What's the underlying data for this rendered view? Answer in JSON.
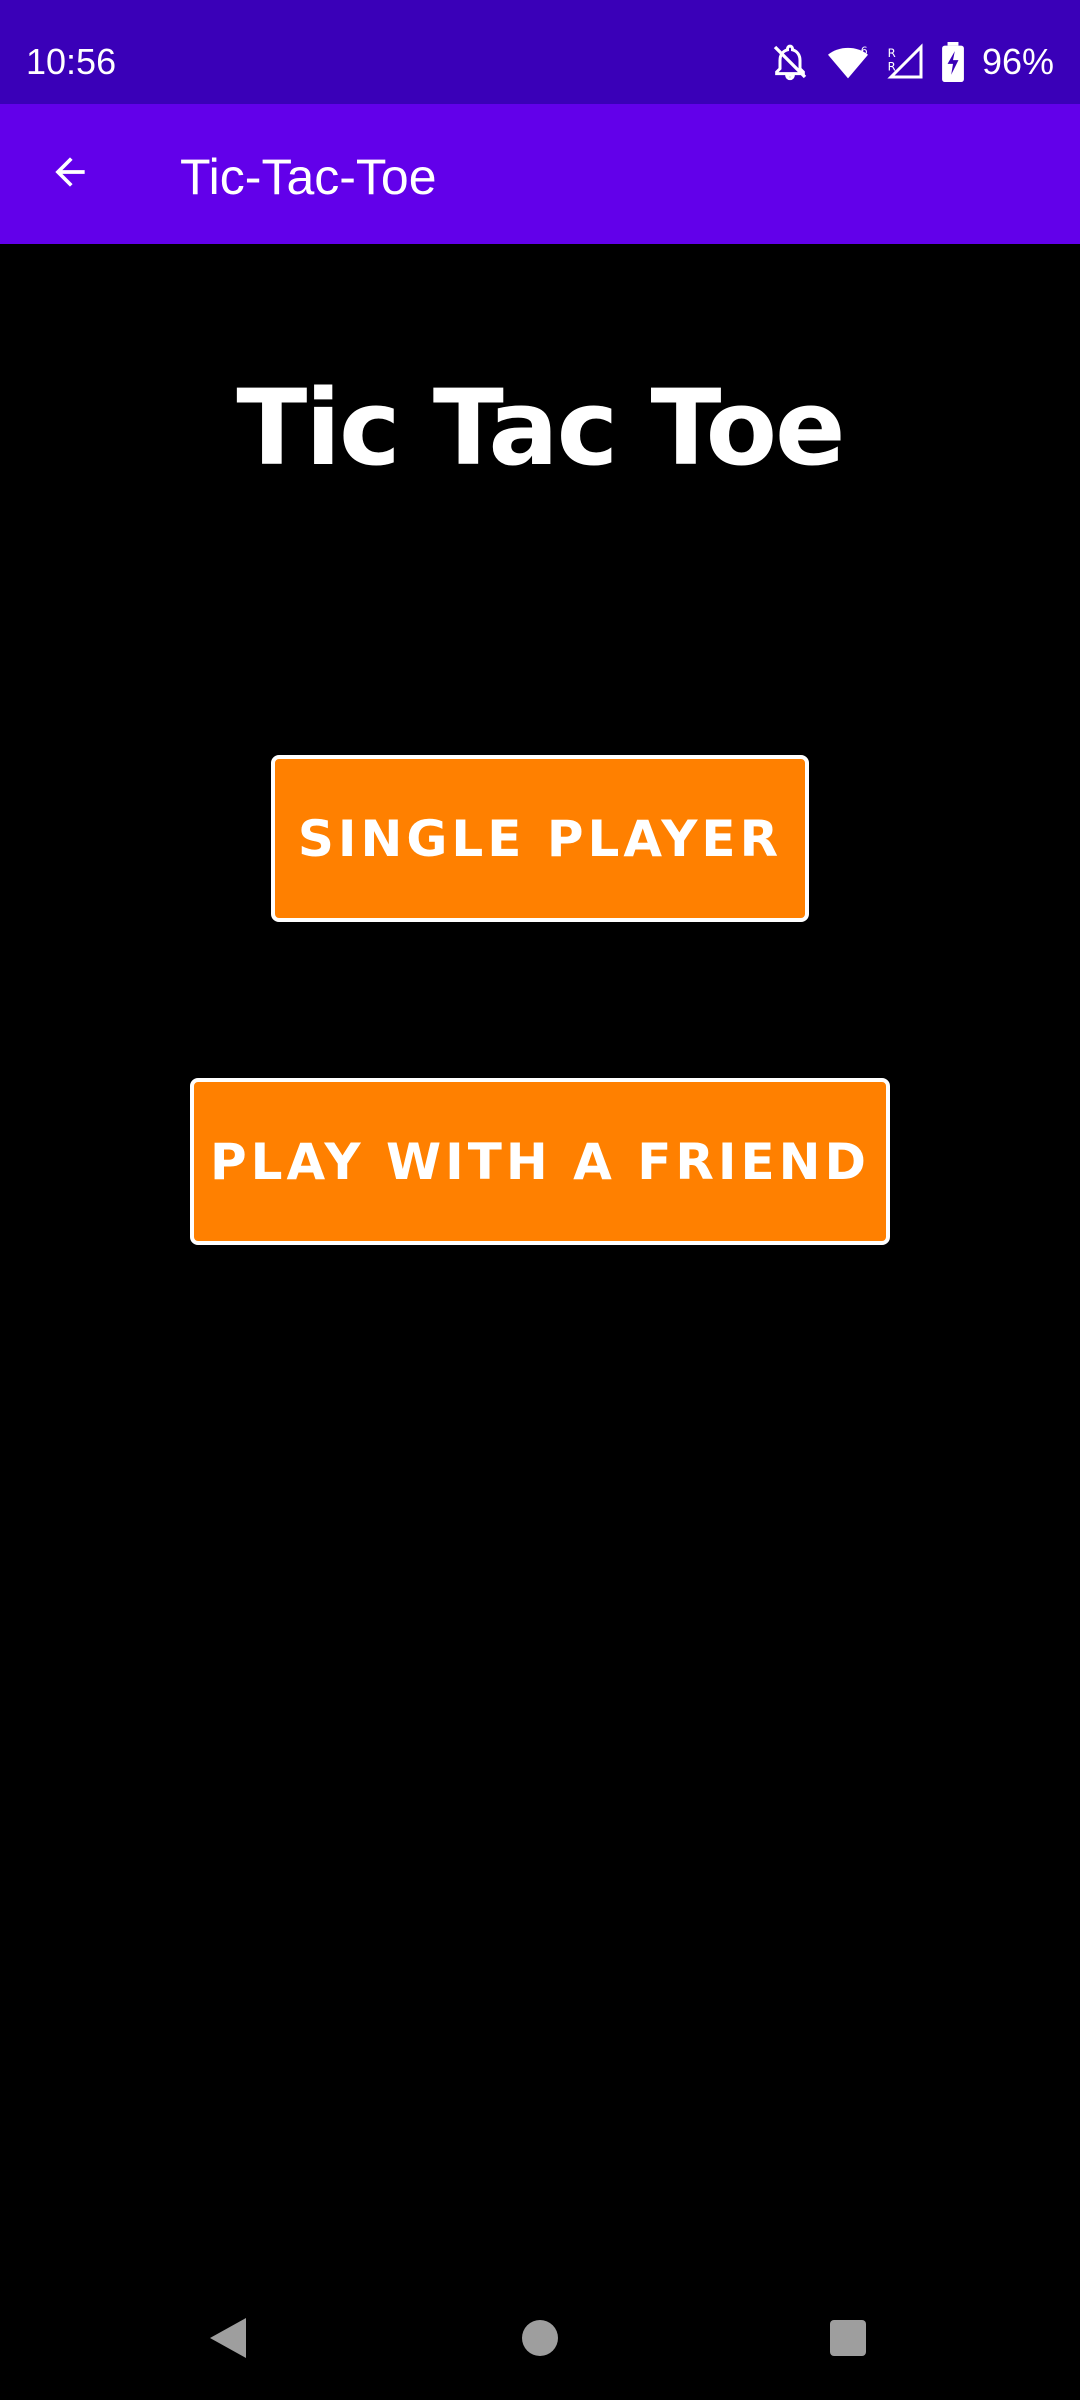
{
  "status_bar": {
    "time": "10:56",
    "battery": "96%",
    "icons": [
      "notifications-off-icon",
      "wifi-icon",
      "signal-icon",
      "battery-charging-icon"
    ]
  },
  "app_bar": {
    "title": "Tic-Tac-Toe",
    "back_icon": "arrow-left-icon",
    "color": "#6200ea"
  },
  "main": {
    "heading": "Tic Tac Toe",
    "single_player_label": "SINGLE PLAYER",
    "play_with_friend_label": "PLAY WITH A FRIEND",
    "button_color": "#ff8000"
  },
  "nav_bar": {
    "icons": [
      "nav-back-icon",
      "nav-home-icon",
      "nav-recents-icon"
    ]
  }
}
